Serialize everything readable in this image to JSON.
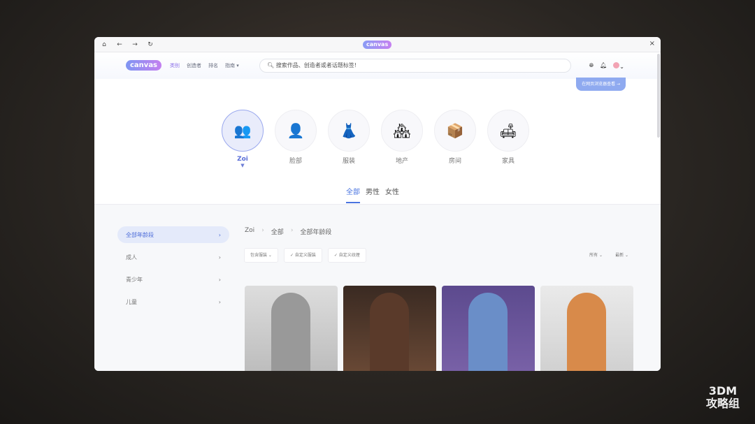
{
  "titlebar": {
    "logo": "canvas",
    "icons": [
      "home-icon",
      "back-icon",
      "forward-icon",
      "refresh-icon"
    ],
    "close": "×"
  },
  "header": {
    "logo": "canvas",
    "nav": [
      "类别",
      "创造者",
      "排名",
      "指南 ▾"
    ],
    "search_placeholder": "搜索作品、创造者或者话题标签!",
    "web_button": "在网页浏览器查看 →"
  },
  "categories": [
    {
      "label": "Zoi",
      "icon": "👥"
    },
    {
      "label": "脸部",
      "icon": "👤"
    },
    {
      "label": "服装",
      "icon": "👗"
    },
    {
      "label": "地产",
      "icon": "🏘"
    },
    {
      "label": "房间",
      "icon": "📦"
    },
    {
      "label": "家具",
      "icon": "🛋"
    }
  ],
  "tabs": [
    "全部",
    "男性",
    "女性"
  ],
  "sidebar": [
    "全部年龄段",
    "成人",
    "青少年",
    "儿童"
  ],
  "breadcrumb": [
    "Zoi",
    "全部",
    "全部年龄段"
  ],
  "filters": [
    "包含服装 ⌄",
    "✓ 自定义服装",
    "✓ 自定义纹理"
  ],
  "sorts": [
    "所有 ⌄",
    "最新 ⌄"
  ],
  "watermark": {
    "line1": "3DM",
    "line2": "攻略组"
  }
}
